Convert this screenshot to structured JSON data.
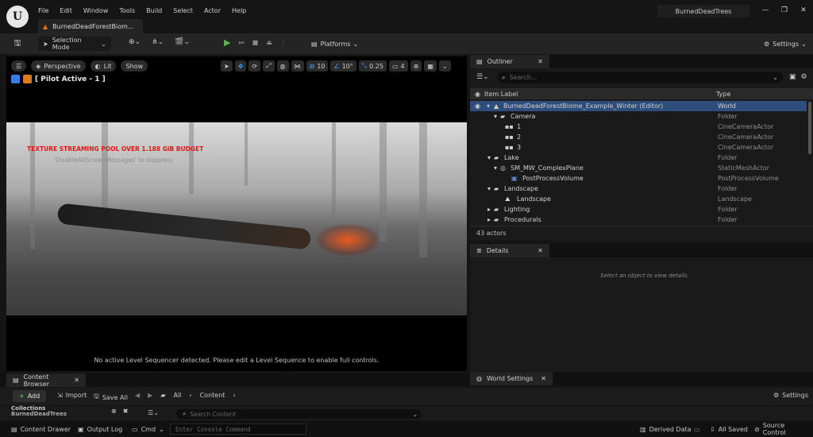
{
  "app": {
    "project_name": "BurnedDeadTrees",
    "document_tab": "BurnedDeadForestBiom...",
    "logo_text": "U"
  },
  "menu": [
    "File",
    "Edit",
    "Window",
    "Tools",
    "Build",
    "Select",
    "Actor",
    "Help"
  ],
  "toolbar": {
    "selection_mode": "Selection Mode",
    "platforms": "Platforms",
    "settings": "Settings"
  },
  "viewport": {
    "perspective": "Perspective",
    "lit": "Lit",
    "show": "Show",
    "grid_snap": "10",
    "rotation_snap": "10°",
    "scale_snap": "0.25",
    "camera_speed": "4",
    "pilot_label": "[ Pilot Active - 1 ]",
    "warning": "TEXTURE STREAMING POOL OVER 1.188 GiB BUDGET",
    "warning_hint": "'DisableAllScreenMessages' to suppress",
    "sequencer_message": "No active Level Sequencer detected. Please edit a Level Sequence to enable full controls."
  },
  "outliner": {
    "tab": "Outliner",
    "search_placeholder": "Search...",
    "col_label": "Item Label",
    "col_type": "Type",
    "rows": [
      {
        "label": "BurnedDeadForestBiome_Example_Winter (Editor)",
        "type": "World"
      },
      {
        "label": "Camera",
        "type": "Folder"
      },
      {
        "label": "1",
        "type": "CineCameraActor"
      },
      {
        "label": "2",
        "type": "CineCameraActor"
      },
      {
        "label": "3",
        "type": "CineCameraActor"
      },
      {
        "label": "Lake",
        "type": "Folder"
      },
      {
        "label": "SM_MW_ComplexPlane",
        "type": "StaticMeshActor"
      },
      {
        "label": "PostProcessVolume",
        "type": "PostProcessVolume"
      },
      {
        "label": "Landscape",
        "type": "Folder"
      },
      {
        "label": "Landscape",
        "type": "Landscape"
      },
      {
        "label": "Lighting",
        "type": "Folder"
      },
      {
        "label": "Procedurals",
        "type": "Folder"
      }
    ],
    "count": "43 actors"
  },
  "details": {
    "tab": "Details",
    "empty": "Select an object to view details."
  },
  "world_settings": {
    "tab": "World Settings"
  },
  "content_browser": {
    "tab": "Content Browser",
    "add": "Add",
    "import": "Import",
    "save_all": "Save All",
    "path_all": "All",
    "path_content": "Content",
    "settings": "Settings",
    "collections": "Collections",
    "collections_sub": "BurnedDeadTrees",
    "search_placeholder": "Search Content"
  },
  "statusbar": {
    "content_drawer": "Content Drawer",
    "output_log": "Output Log",
    "cmd": "Cmd",
    "console_placeholder": "Enter Console Command",
    "derived_data": "Derived Data",
    "all_saved": "All Saved",
    "source_control": "Source Control"
  }
}
